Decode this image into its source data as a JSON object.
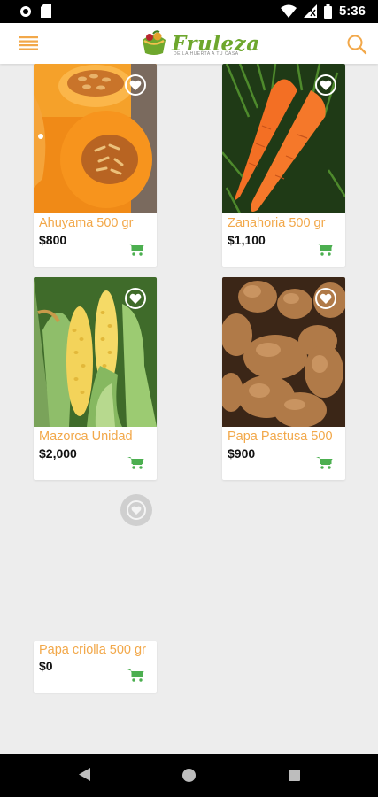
{
  "status_bar": {
    "time": "5:36"
  },
  "app": {
    "logo_text_main": "Fruleza",
    "logo_tagline": "DE LA HUERTA A TU CASA"
  },
  "products": [
    {
      "name": "Ahuyama 500 gr",
      "price": "$800"
    },
    {
      "name": "Zanahoria 500 gr",
      "price": "$1,100"
    },
    {
      "name": "Mazorca Unidad",
      "price": "$2,000"
    },
    {
      "name": "Papa Pastusa 500",
      "price": "$900"
    },
    {
      "name": "Papa criolla 500 gr",
      "price": "$0"
    }
  ],
  "colors": {
    "accent_orange": "#f2a84a",
    "cart_green": "#4caf50",
    "logo_green": "#6ea72d",
    "logo_red": "#b8262e"
  }
}
